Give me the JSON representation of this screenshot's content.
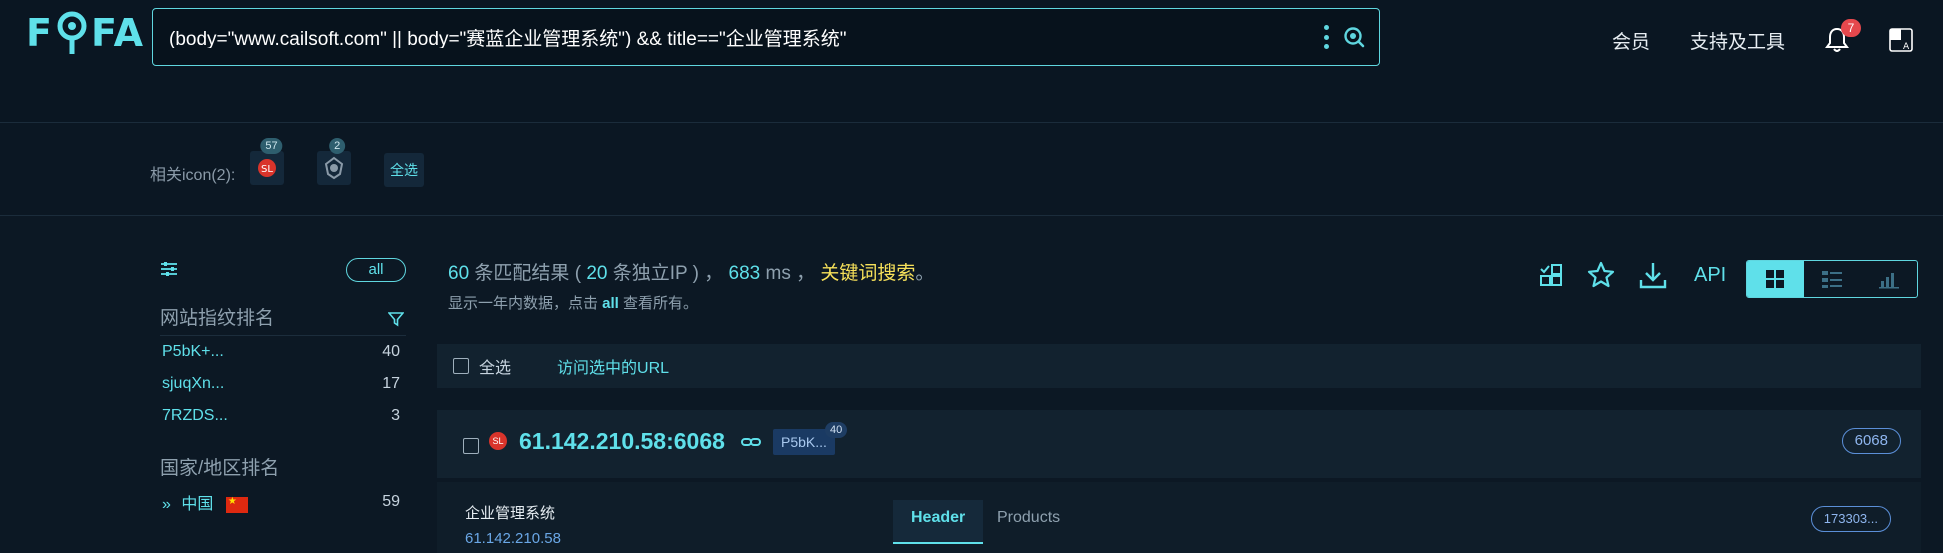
{
  "header": {
    "logo": "FOFA",
    "search_query": "(body=\"www.cailsoft.com\" || body=\"赛蓝企业管理系统\") && title==\"企业管理系统\"",
    "nav": {
      "member": "会员",
      "tools": "支持及工具"
    },
    "notification_count": "7"
  },
  "related_icons": {
    "label": "相关icon(2):",
    "items": [
      {
        "count": "57"
      },
      {
        "count": "2"
      }
    ],
    "select_all": "全选"
  },
  "sidebar": {
    "all_label": "all",
    "fingerprint_title": "网站指纹排名",
    "fingerprints": [
      {
        "name": "P5bK+...",
        "count": "40"
      },
      {
        "name": "sjuqXn...",
        "count": "17"
      },
      {
        "name": "7RZDS...",
        "count": "3"
      }
    ],
    "country_title": "国家/地区排名",
    "countries": [
      {
        "name": "中国",
        "count": "59"
      }
    ]
  },
  "stats": {
    "results": "60",
    "results_label": " 条匹配结果 ( ",
    "ips": "20",
    "ips_label": " 条独立IP ) ， ",
    "ms": "683",
    "ms_label": " ms ， ",
    "keyword_search": "关键词搜索",
    "end": "。",
    "sub_prefix": "显示一年内数据，点击 ",
    "sub_all": "all",
    "sub_suffix": " 查看所有。"
  },
  "toolbar": {
    "api": "API"
  },
  "select_bar": {
    "select_all": "全选",
    "visit_selected": "访问选中的URL"
  },
  "result": {
    "host": "61.142.210.58:6068",
    "fp_tag": "P5bK...",
    "fp_tag_count": "40",
    "port": "6068",
    "title": "企业管理系统",
    "ip": "61.142.210.58",
    "tabs": [
      "Header",
      "Products"
    ],
    "hash": "173303..."
  },
  "colors": {
    "accent": "#5fe0ea",
    "keyword": "#f7e15a",
    "background": "#0c1824"
  }
}
